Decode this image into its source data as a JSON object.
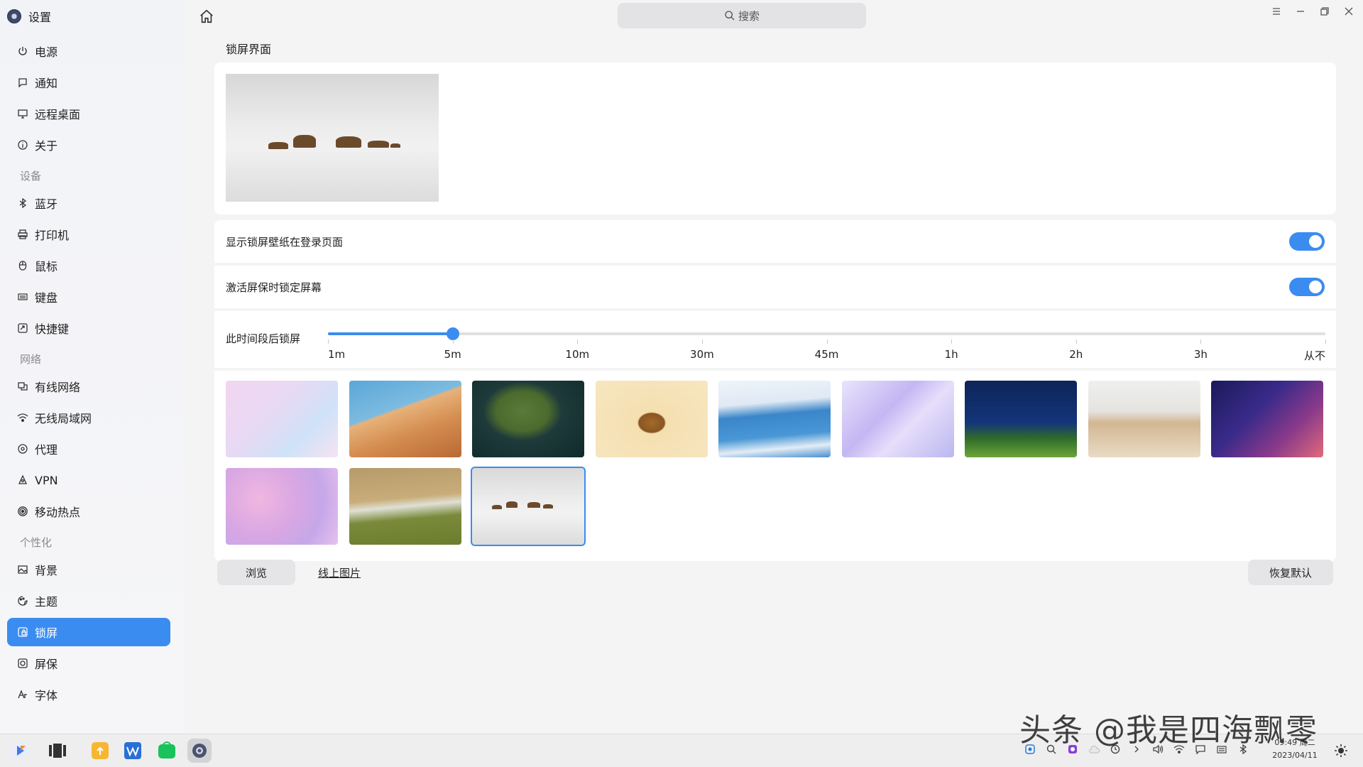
{
  "app": {
    "title": "设置"
  },
  "search": {
    "placeholder": "搜索"
  },
  "sidebar": {
    "groups": [
      {
        "items": [
          {
            "label": "电源",
            "icon": "power-icon"
          },
          {
            "label": "通知",
            "icon": "notification-icon"
          },
          {
            "label": "远程桌面",
            "icon": "remote-desktop-icon"
          },
          {
            "label": "关于",
            "icon": "info-icon"
          }
        ]
      },
      {
        "title": "设备",
        "items": [
          {
            "label": "蓝牙",
            "icon": "bluetooth-icon"
          },
          {
            "label": "打印机",
            "icon": "printer-icon"
          },
          {
            "label": "鼠标",
            "icon": "mouse-icon"
          },
          {
            "label": "键盘",
            "icon": "keyboard-icon"
          },
          {
            "label": "快捷键",
            "icon": "shortcut-icon"
          }
        ]
      },
      {
        "title": "网络",
        "items": [
          {
            "label": "有线网络",
            "icon": "wired-network-icon"
          },
          {
            "label": "无线局域网",
            "icon": "wifi-icon"
          },
          {
            "label": "代理",
            "icon": "proxy-icon"
          },
          {
            "label": "VPN",
            "icon": "vpn-icon"
          },
          {
            "label": "移动热点",
            "icon": "hotspot-icon"
          }
        ]
      },
      {
        "title": "个性化",
        "items": [
          {
            "label": "背景",
            "icon": "background-icon"
          },
          {
            "label": "主题",
            "icon": "theme-icon"
          },
          {
            "label": "锁屏",
            "icon": "lockscreen-icon",
            "active": true
          },
          {
            "label": "屏保",
            "icon": "screensaver-icon"
          },
          {
            "label": "字体",
            "icon": "font-icon"
          }
        ]
      }
    ]
  },
  "main": {
    "section_title": "锁屏界面",
    "settings": [
      {
        "label": "显示锁屏壁纸在登录页面",
        "enabled": true
      },
      {
        "label": "激活屏保时锁定屏幕",
        "enabled": true
      }
    ],
    "lock_after": {
      "label": "此时间段后锁屏",
      "options": [
        "1m",
        "5m",
        "10m",
        "30m",
        "45m",
        "1h",
        "2h",
        "3h",
        "从不"
      ],
      "selected": "5m"
    },
    "wallpapers": [
      {
        "name": "pastel-staircase",
        "selected": false
      },
      {
        "name": "desert-dune",
        "selected": false
      },
      {
        "name": "aerial-island",
        "selected": false
      },
      {
        "name": "giraffe",
        "selected": false
      },
      {
        "name": "blue-ice",
        "selected": false
      },
      {
        "name": "lavender-wave",
        "selected": false
      },
      {
        "name": "night-hill-child",
        "selected": false
      },
      {
        "name": "building-wall",
        "selected": false
      },
      {
        "name": "purple-curve",
        "selected": false
      },
      {
        "name": "pink-petals",
        "selected": false
      },
      {
        "name": "coastline-aerial",
        "selected": false
      },
      {
        "name": "foggy-rocks",
        "selected": true
      }
    ],
    "buttons": {
      "browse": "浏览",
      "online": "线上图片",
      "restore": "恢复默认"
    }
  },
  "taskbar": {
    "clock_time": "09:49 周二",
    "clock_date": "2023/04/11"
  },
  "watermark": "头条 @我是四海飘零",
  "colors": {
    "accent": "#3a8cf0"
  }
}
